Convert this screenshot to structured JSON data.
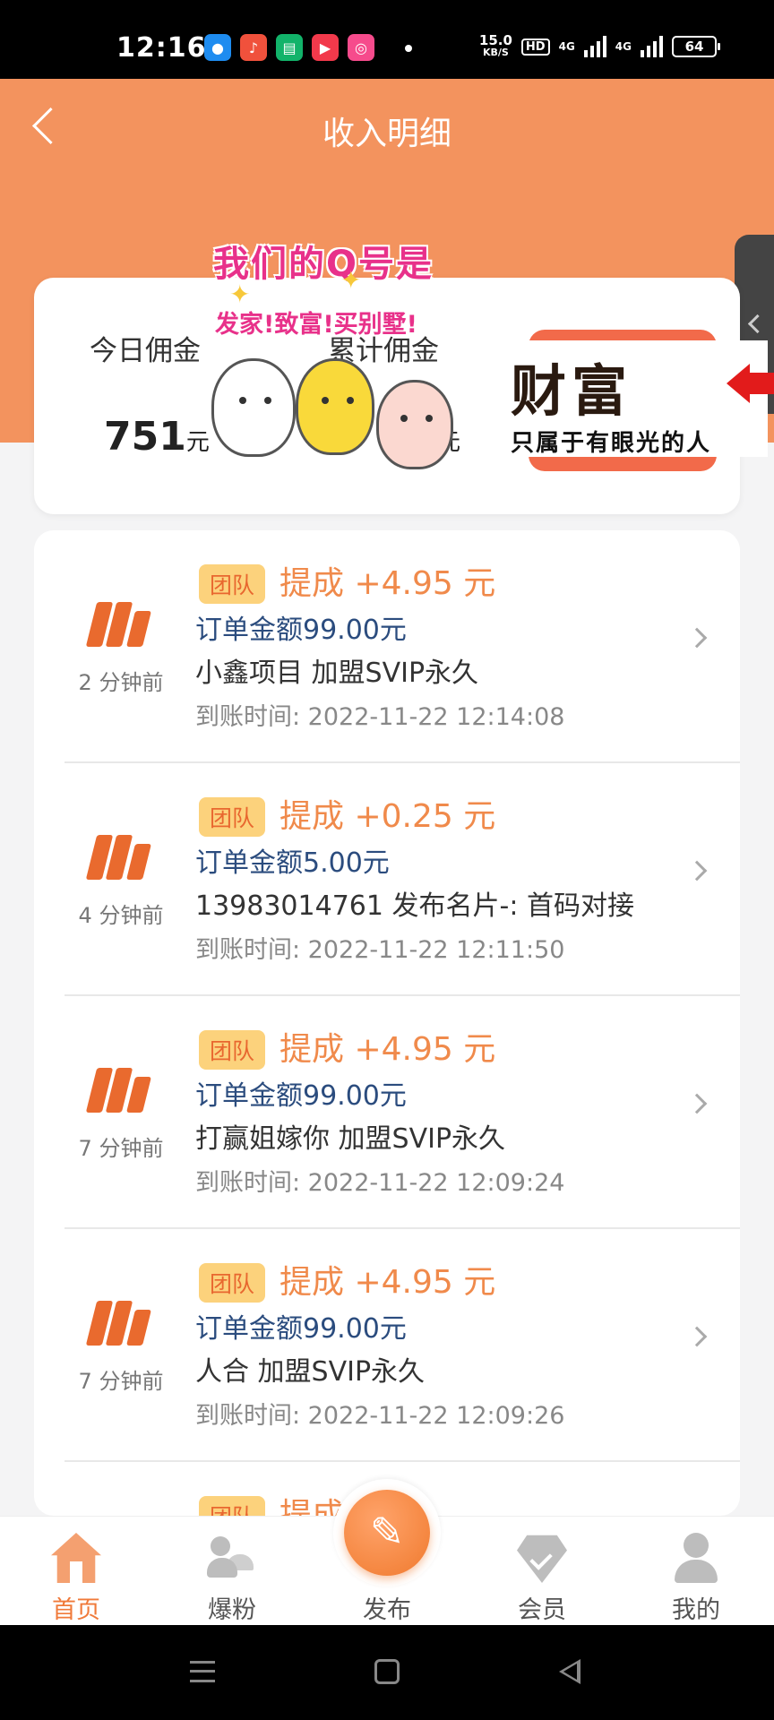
{
  "status_bar": {
    "time": "12:16",
    "net_speed_value": "15.0",
    "net_speed_unit": "KB/S",
    "hd_label": "HD",
    "signal1_label": "4G",
    "signal2_label": "4G",
    "battery": "64",
    "apps": [
      "qq-icon",
      "music-icon",
      "chat-icon",
      "video-icon",
      "camera-icon"
    ]
  },
  "header": {
    "title": "收入明细",
    "accent_color": "#f3935e"
  },
  "promo_overlay": {
    "line1": "我们的Q号是",
    "line2": "发家!致富!买别墅!",
    "wealth_title": "财富",
    "wealth_subtitle": "只属于有眼光的人"
  },
  "summary": {
    "today_label": "今日佣金",
    "total_label": "累计佣金",
    "today_value": "751",
    "today_unit": "元",
    "total_unit": "元"
  },
  "records": [
    {
      "tag": "团队",
      "commission": "提成 +4.95 元",
      "order_amount": "订单金额99.00元",
      "description": "小鑫项目 加盟SVIP永久",
      "time": "到账时间: 2022-11-22 12:14:08",
      "ago": "2 分钟前"
    },
    {
      "tag": "团队",
      "commission": "提成 +0.25 元",
      "order_amount": "订单金额5.00元",
      "description": "13983014761 发布名片-:  首码对接",
      "time": "到账时间: 2022-11-22 12:11:50",
      "ago": "4 分钟前"
    },
    {
      "tag": "团队",
      "commission": "提成 +4.95 元",
      "order_amount": "订单金额99.00元",
      "description": "打赢姐嫁你 加盟SVIP永久",
      "time": "到账时间: 2022-11-22 12:09:24",
      "ago": "7 分钟前"
    },
    {
      "tag": "团队",
      "commission": "提成 +4.95 元",
      "order_amount": "订单金额99.00元",
      "description": "人合 加盟SVIP永久",
      "time": "到账时间: 2022-11-22 12:09:26",
      "ago": "7 分钟前"
    },
    {
      "tag": "团队",
      "commission": "提成",
      "order_amount": "",
      "description": "",
      "time": "",
      "ago": ""
    }
  ],
  "bottom_nav": {
    "home": "首页",
    "fans": "爆粉",
    "publish": "发布",
    "vip": "会员",
    "me": "我的"
  }
}
